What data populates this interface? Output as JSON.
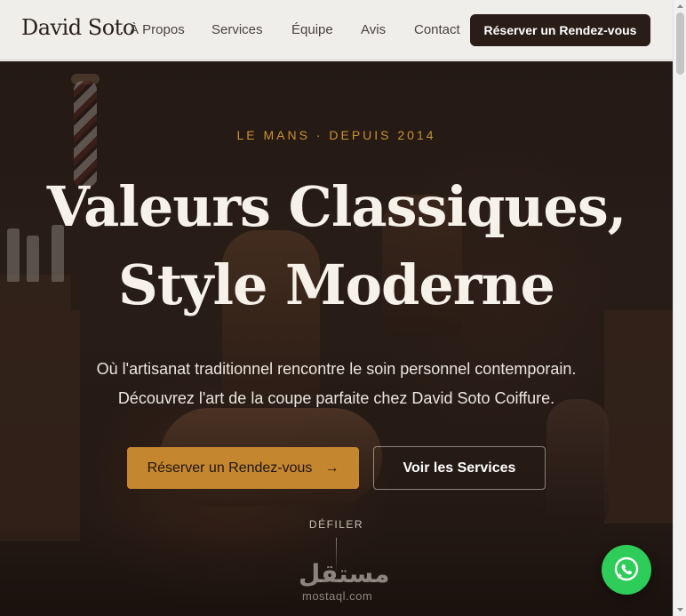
{
  "nav": {
    "brand": "David Soto",
    "links": [
      "À Propos",
      "Services",
      "Équipe",
      "Avis",
      "Contact"
    ],
    "cta_label": "Réserver un Rendez-vous"
  },
  "hero": {
    "eyebrow": "LE MANS · DEPUIS 2014",
    "headline_line1": "Valeurs Classiques,",
    "headline_line2": "Style Moderne",
    "subline_line1": "Où l'artisanat traditionnel rencontre le soin personnel contemporain.",
    "subline_line2": "Découvrez l'art de la coupe parfaite chez David Soto Coiffure.",
    "primary_button": "Réserver un Rendez-vous",
    "primary_arrow": "→",
    "secondary_button": "Voir les Services",
    "scroll_label": "DÉFILER"
  },
  "watermark": {
    "arabic": "مستقل",
    "latin": "mostaql.com"
  },
  "floating": {
    "icon": "whatsapp-icon"
  },
  "colors": {
    "accent": "#c4862f",
    "dark": "#2a1d18",
    "whatsapp": "#2ecc58"
  }
}
